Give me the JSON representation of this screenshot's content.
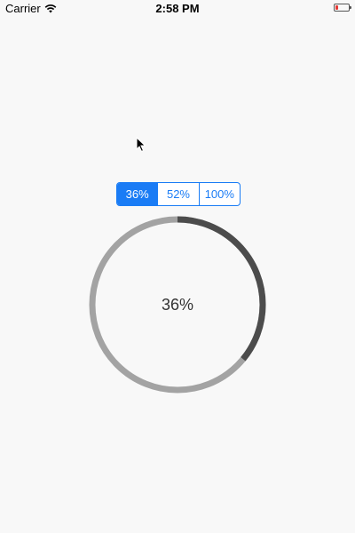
{
  "status_bar": {
    "carrier": "Carrier",
    "time": "2:58 PM",
    "battery_color": "#e53935"
  },
  "segmented": {
    "selected_index": 0,
    "items": [
      {
        "label": "36%"
      },
      {
        "label": "52%"
      },
      {
        "label": "100%"
      }
    ],
    "accent_color": "#1a7cf5"
  },
  "progress": {
    "value": 0.36,
    "label": "36%",
    "track_color": "#a3a3a3",
    "progress_color": "#4c4c4c"
  },
  "icons": {
    "wifi": "wifi-icon",
    "cursor": "cursor-icon",
    "battery": "battery-icon"
  }
}
